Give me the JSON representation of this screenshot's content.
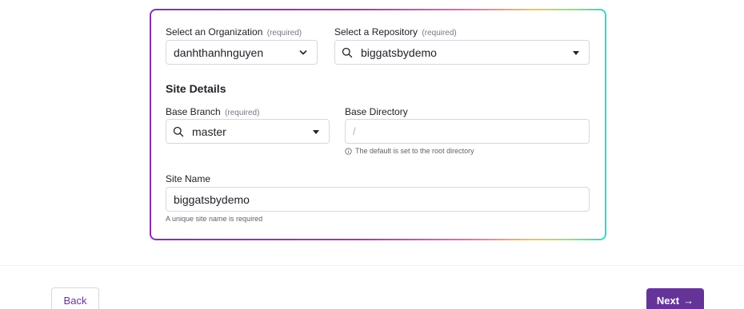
{
  "form": {
    "organization": {
      "label": "Select an Organization",
      "required": "(required)",
      "value": "danhthanhnguyen"
    },
    "repository": {
      "label": "Select a Repository",
      "required": "(required)",
      "value": "biggatsbydemo"
    },
    "site_details_heading": "Site Details",
    "base_branch": {
      "label": "Base Branch",
      "required": "(required)",
      "value": "master"
    },
    "base_directory": {
      "label": "Base Directory",
      "placeholder": "/",
      "hint": "The default is set to the root directory"
    },
    "site_name": {
      "label": "Site Name",
      "value": "biggatsbydemo",
      "hint": "A unique site name is required"
    }
  },
  "footer": {
    "back_label": "Back",
    "next_label": "Next",
    "next_arrow": "→"
  },
  "colors": {
    "accent": "#663399",
    "gradient": [
      "#8a2fb0",
      "#ec6cb0",
      "#f4c64a",
      "#8fe67a",
      "#2fd6cf"
    ]
  },
  "icons": {
    "search": "search-icon",
    "chevron": "chevron-down-icon",
    "caret": "caret-down-icon",
    "info": "info-icon",
    "arrow": "arrow-right-icon"
  }
}
